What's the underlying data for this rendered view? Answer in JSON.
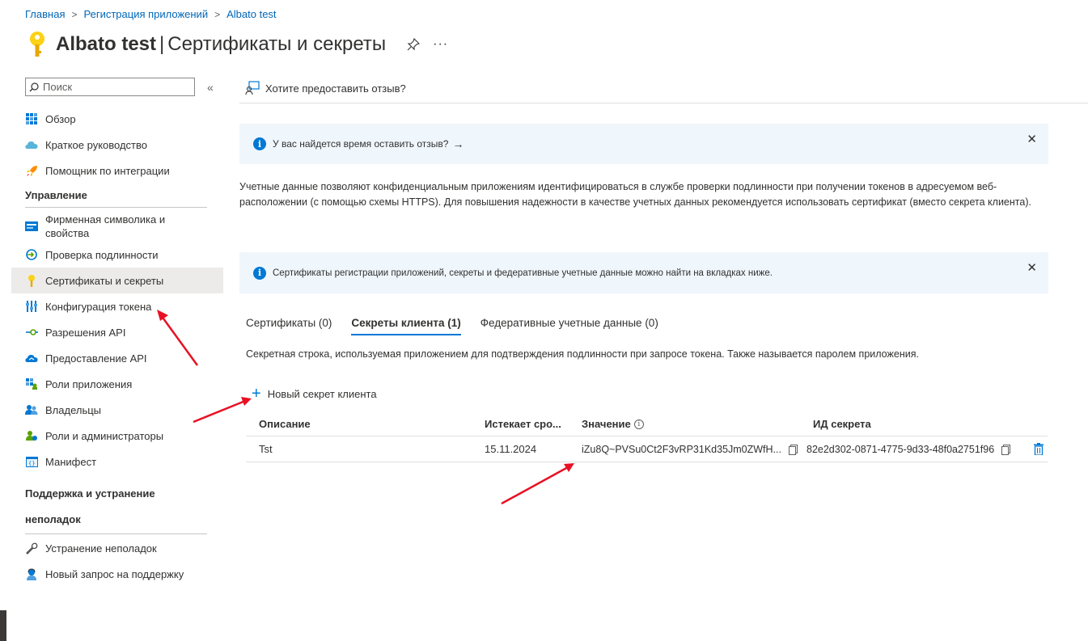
{
  "breadcrumb": {
    "items": [
      "Главная",
      "Регистрация приложений",
      "Albato test"
    ]
  },
  "header": {
    "app_name": "Albato test",
    "pipe": "|",
    "page_title": "Сертификаты и секреты",
    "more": "···"
  },
  "sidebar": {
    "search_placeholder": "Поиск",
    "collapse": "«",
    "items_top": [
      {
        "label": "Обзор",
        "icon": "grid-icon"
      },
      {
        "label": "Краткое руководство",
        "icon": "cloud-icon"
      },
      {
        "label": "Помощник по интеграции",
        "icon": "rocket-icon"
      }
    ],
    "section_manage": "Управление",
    "items_manage": [
      {
        "label": "Фирменная символика и свойства",
        "icon": "branding-icon"
      },
      {
        "label": "Проверка подлинности",
        "icon": "auth-icon"
      },
      {
        "label": "Сертификаты и секреты",
        "icon": "key-icon",
        "active": true
      },
      {
        "label": "Конфигурация токена",
        "icon": "token-icon"
      },
      {
        "label": "Разрешения API",
        "icon": "api-permissions-icon"
      },
      {
        "label": "Предоставление API",
        "icon": "expose-api-icon"
      },
      {
        "label": "Роли приложения",
        "icon": "app-roles-icon"
      },
      {
        "label": "Владельцы",
        "icon": "owners-icon"
      },
      {
        "label": "Роли и администраторы",
        "icon": "roles-admins-icon"
      },
      {
        "label": "Манифест",
        "icon": "manifest-icon"
      }
    ],
    "section_support": "Поддержка и устранение",
    "section_support_2": "неполадок",
    "items_support": [
      {
        "label": "Устранение неполадок",
        "icon": "wrench-icon"
      },
      {
        "label": "Новый запрос на поддержку",
        "icon": "support-icon"
      }
    ]
  },
  "main": {
    "feedback": "Хотите предоставить отзыв?",
    "banner1": "У вас найдется время оставить отзыв?",
    "banner1_arrow": "→",
    "description": "Учетные данные позволяют конфиденциальным приложениям идентифицироваться в службе проверки подлинности при получении токенов в адресуемом веб-расположении (с помощью схемы HTTPS). Для повышения надежности в качестве учетных данных рекомендуется использовать сертификат (вместо секрета клиента).",
    "banner2": "Сертификаты регистрации приложений, секреты и федеративные учетные данные можно найти на вкладках ниже.",
    "close": "✕",
    "tabs": [
      {
        "label": "Сертификаты (0)",
        "active": false
      },
      {
        "label": "Секреты клиента (1)",
        "active": true
      },
      {
        "label": "Федеративные учетные данные (0)",
        "active": false
      }
    ],
    "tab_description": "Секретная строка, используемая приложением для подтверждения подлинности при запросе токена. Также называется паролем приложения.",
    "new_secret": "Новый секрет клиента",
    "table": {
      "headers": [
        "Описание",
        "Истекает сро...",
        "Значение",
        "ИД секрета"
      ],
      "rows": [
        {
          "description": "Tst",
          "expires": "15.11.2024",
          "value": "iZu8Q~PVSu0Ct2F3vRP31Kd35Jm0ZWfH...",
          "secret_id": "82e2d302-0871-4775-9d33-48f0a2751f96"
        }
      ]
    }
  },
  "colors": {
    "accent": "#0078d4",
    "link": "#0067b8",
    "banner_bg": "#eff6fc",
    "active_nav_bg": "#edebe9",
    "annotation_arrow": "#e81123"
  }
}
